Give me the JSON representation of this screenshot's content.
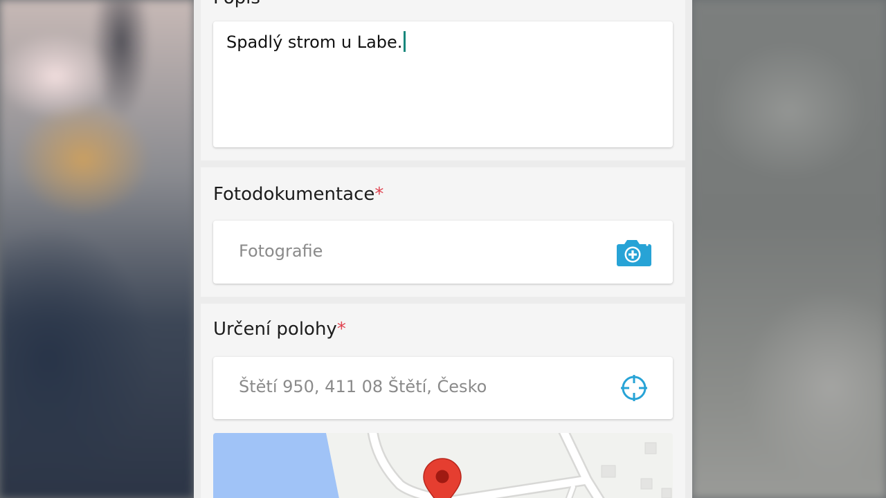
{
  "popis": {
    "title": "Popis",
    "value": "Spadlý strom u Labe."
  },
  "fotodokumentace": {
    "title": "Fotodokumentace",
    "required_mark": "*",
    "placeholder": "Fotografie",
    "icon": "add-a-photo-icon"
  },
  "poloha": {
    "title": "Určení polohy",
    "required_mark": "*",
    "address": "Štětí 950, 411 08 Štětí, Česko",
    "icon": "gps-crosshair-icon"
  },
  "map": {
    "marker_icon": "map-pin-icon",
    "water_color": "#a0c3f7",
    "marker_color": "#e53e30"
  },
  "colors": {
    "accent": "#27a3d6",
    "required": "#e0424f",
    "caret": "#17877c"
  }
}
